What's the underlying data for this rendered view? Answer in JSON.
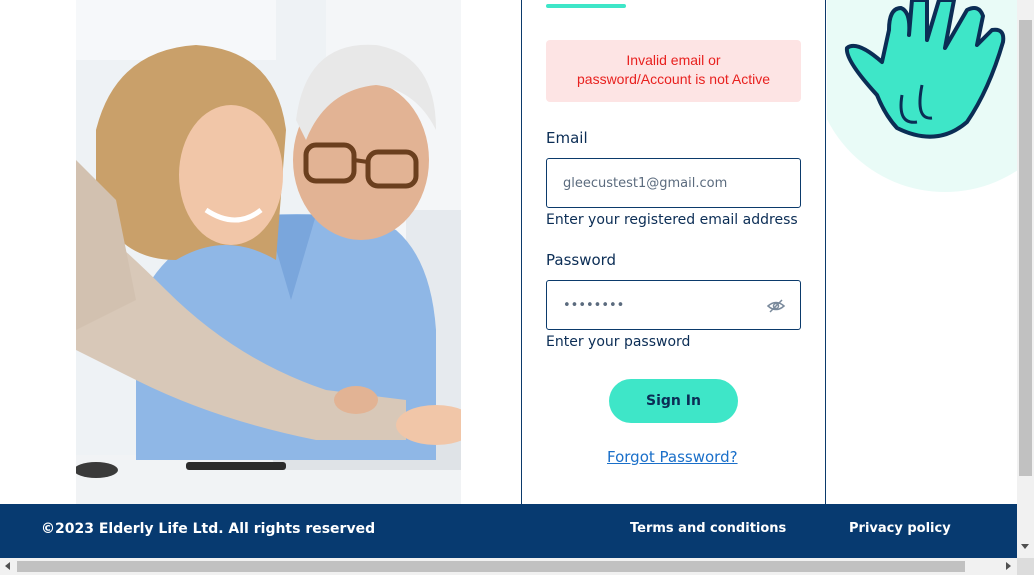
{
  "login": {
    "error_message_line1": "Invalid email or",
    "error_message_line2": "password/Account is not Active",
    "email_label": "Email",
    "email_value": "gleecustest1@gmail.com",
    "email_hint": "Enter your registered email address",
    "password_label": "Password",
    "password_value": "••••••••",
    "password_hint": "Enter your password",
    "signin_label": "Sign In",
    "forgot_label": "Forgot Password?"
  },
  "footer": {
    "copyright": "©2023 Elderly Life Ltd. All rights reserved",
    "terms_label": "Terms and conditions",
    "privacy_label": "Privacy policy"
  },
  "colors": {
    "accent": "#3ee6c8",
    "navy": "#073a70",
    "error_bg": "#fde4e4",
    "error_text": "#e8211f",
    "link": "#1a6fc9"
  },
  "icons": {
    "eye_toggle": "eye-slash-icon",
    "hand_logo": "hand-logo-icon"
  }
}
